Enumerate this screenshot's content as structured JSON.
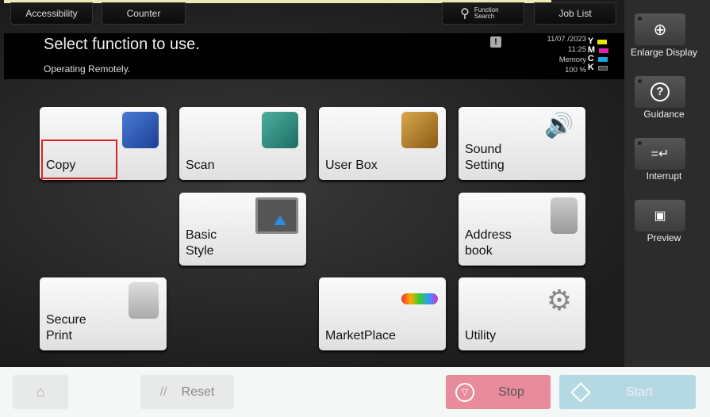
{
  "top_tabs": {
    "accessibility": "Accessibility",
    "counter": "Counter",
    "function_search": "Function Search",
    "job_list": "Job List"
  },
  "message": {
    "title": "Select function to use.",
    "subtitle": "Operating Remotely.",
    "date": "11/07 /2023",
    "time": "11:25",
    "memory_label": "Memory",
    "memory_value": "100 %"
  },
  "toner": [
    {
      "letter": "Y",
      "color": "#f0e000"
    },
    {
      "letter": "M",
      "color": "#e020b0"
    },
    {
      "letter": "C",
      "color": "#1fa0e0"
    },
    {
      "letter": "K",
      "color": "#444444"
    }
  ],
  "sidebar": {
    "enlarge": "Enlarge Display",
    "guidance": "Guidance",
    "interrupt": "Interrupt",
    "preview": "Preview"
  },
  "tiles": {
    "copy": "Copy",
    "scan": "Scan",
    "user_box": "User Box",
    "sound": "Sound\nSetting",
    "basic_style": "Basic\nStyle",
    "address_book": "Address\nbook",
    "secure_print": "Secure\nPrint",
    "marketplace": "MarketPlace",
    "utility": "Utility"
  },
  "bottom": {
    "reset": "Reset",
    "stop": "Stop",
    "start": "Start"
  },
  "colors": {
    "stop": "#e88c9c",
    "start": "#b5d9e2",
    "highlight": "#e02020"
  }
}
